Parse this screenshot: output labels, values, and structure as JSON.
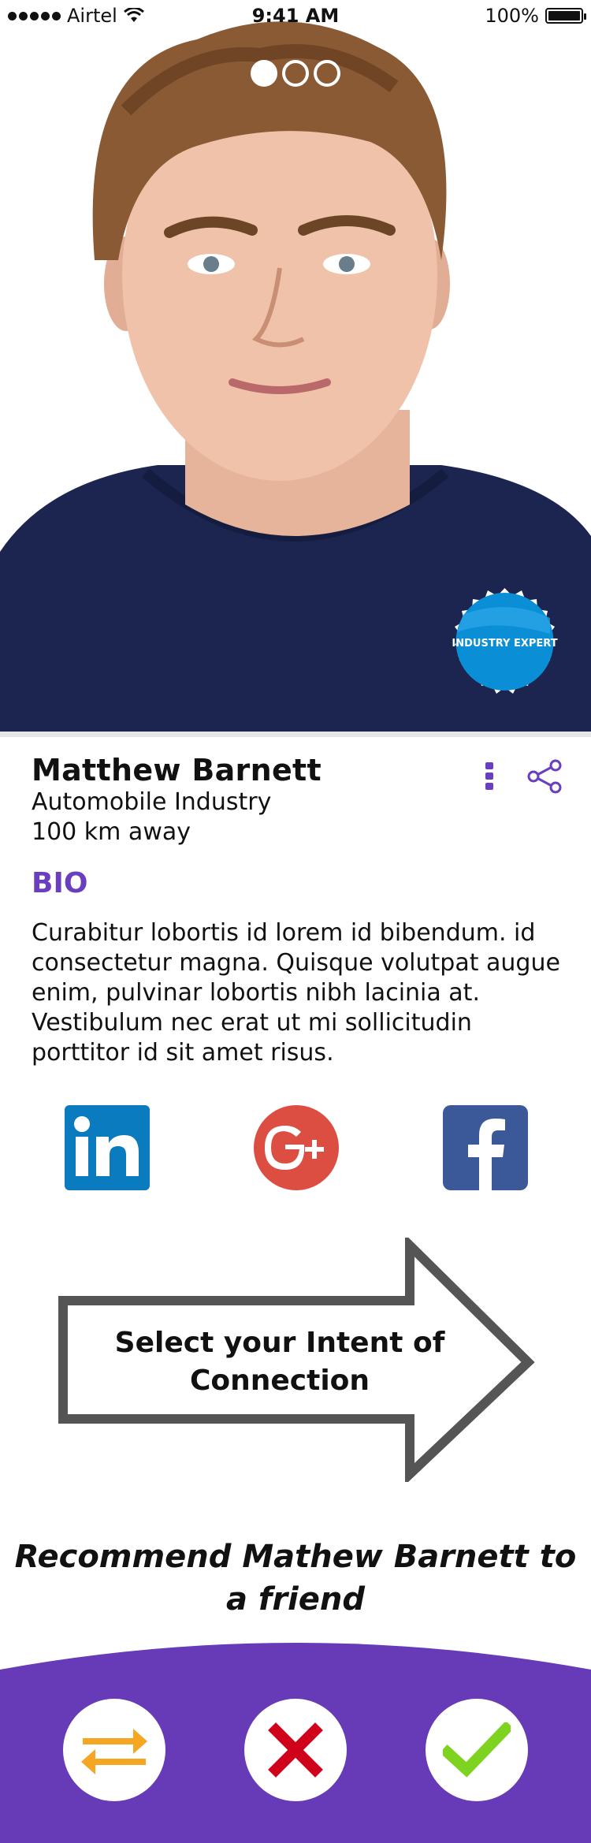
{
  "status_bar": {
    "carrier": "Airtel",
    "time": "9:41 AM",
    "battery_percent_label": "100%",
    "battery_level": 1.0,
    "signal_icon": "signal-dots-icon",
    "wifi_icon": "wifi-icon"
  },
  "photo": {
    "pager_count": 3,
    "pager_active_index": 0,
    "badge_label": "INDUSTRY EXPERT"
  },
  "profile": {
    "name": "Matthew Barnett",
    "industry": "Automobile Industry",
    "distance": "100 km away",
    "more_icon": "vertical-dots-icon",
    "share_icon": "share-icon"
  },
  "bio": {
    "heading": "BIO",
    "text": "Curabitur lobortis id lorem id bibendum. id consectetur magna. Quisque volutpat augue enim, pulvinar lobortis nibh lacinia at. Vestibulum nec erat ut mi sollicitudin porttitor id sit amet risus."
  },
  "social": [
    {
      "name": "LinkedIn",
      "icon": "linkedin-icon",
      "color": "#0a7bbf",
      "glyph": "in"
    },
    {
      "name": "Google Plus",
      "icon": "google-plus-icon",
      "color": "#dc4e41",
      "glyph": "G+"
    },
    {
      "name": "Facebook",
      "icon": "facebook-icon",
      "color": "#3b5998",
      "glyph": "f"
    }
  ],
  "intent": {
    "label": "Select your Intent of Connection"
  },
  "recommend": {
    "text": "Recommend Mathew Barnett to a friend"
  },
  "actions": {
    "swap_icon": "swap-arrows-icon",
    "reject_icon": "close-x-icon",
    "accept_icon": "checkmark-icon"
  },
  "colors": {
    "accent": "#6a3fbf",
    "bottom_bar": "#673ab7",
    "swap": "#f5a623",
    "reject": "#d0021b",
    "accept": "#7ed321",
    "badge": "#0a8fd6"
  }
}
